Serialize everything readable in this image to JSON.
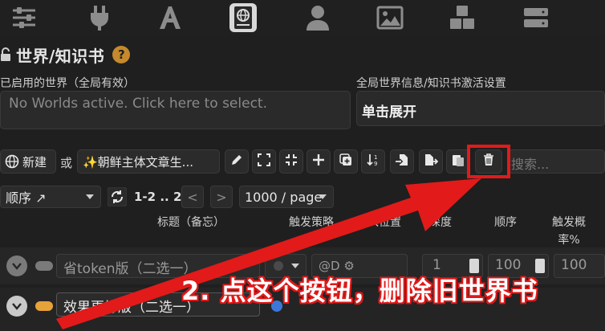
{
  "topbar": {
    "icons": [
      "sliders-icon",
      "plug-icon",
      "font-icon",
      "world-book-icon",
      "user-icon",
      "image-icon",
      "cubes-icon",
      "server-icon"
    ]
  },
  "header": {
    "title": "世界/知识书",
    "help": "?"
  },
  "active_worlds": {
    "label": "已启用的世界（全局有效）",
    "placeholder": "No Worlds active. Click here to select."
  },
  "global_settings": {
    "label": "全局世界信息/知识书激活设置",
    "expand_label": "单击展开"
  },
  "toolbar": {
    "new_label": "新建",
    "or_label": "或",
    "book_name": "✨朝鲜主体文章生...",
    "search_placeholder": "搜索..."
  },
  "controls": {
    "sort_value": "顺序 ↗",
    "page_range": "1-2 .. 2",
    "prev": "<",
    "next": ">",
    "per_page": "1000 / page"
  },
  "columns": {
    "title": "标题（备忘）",
    "trigger_strategy": "触发策略",
    "position": "插入位置",
    "depth": "深度",
    "order": "顺序",
    "probability": "触发概\n率%"
  },
  "entries": [
    {
      "title": "省token版（二选一）",
      "position": "@D ⚙",
      "depth": "1",
      "order": "100",
      "probability": "100",
      "enabled": false
    },
    {
      "title": "效果更好版（二选一）",
      "position": "",
      "depth": "",
      "order": "",
      "probability": "",
      "enabled": true
    }
  ],
  "annotation": {
    "text": "2. 点这个按钮，删除旧世界书"
  },
  "colors": {
    "accent_orange": "#c58a2c",
    "annotation_red": "#e21a1a",
    "toggle_on": "#e8a23a",
    "toggle_off": "#9a9a9a"
  }
}
